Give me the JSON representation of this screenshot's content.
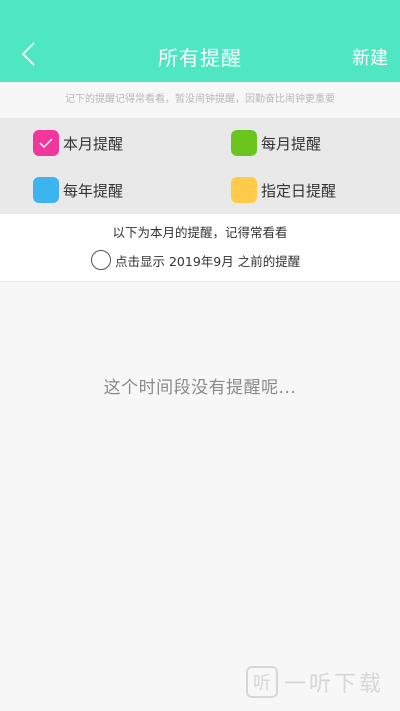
{
  "header": {
    "back_icon": "chevron-left-icon",
    "title": "所有提醒",
    "new_label": "新建",
    "background_color": "#4fe7c2"
  },
  "hint": {
    "text": "记下的提醒记得常看看，暂没闹钟提醒，因勤奋比闹钟更重要"
  },
  "filters": [
    {
      "label": "本月提醒",
      "color": "#f0389c",
      "checked": true
    },
    {
      "label": "每月提醒",
      "color": "#6cc51f",
      "checked": false
    },
    {
      "label": "每年提醒",
      "color": "#3bb4f0",
      "checked": false
    },
    {
      "label": "指定日提醒",
      "color": "#ffcb48",
      "checked": false
    }
  ],
  "info": {
    "line1": "以下为本月的提醒，记得常看看",
    "show_prev": "点击显示 2019年9月 之前的提醒",
    "show_prev_checked": false
  },
  "empty": {
    "message": "这个时间段没有提醒呢..."
  },
  "watermark": {
    "logo_glyph": "听",
    "text": "一听下载"
  }
}
